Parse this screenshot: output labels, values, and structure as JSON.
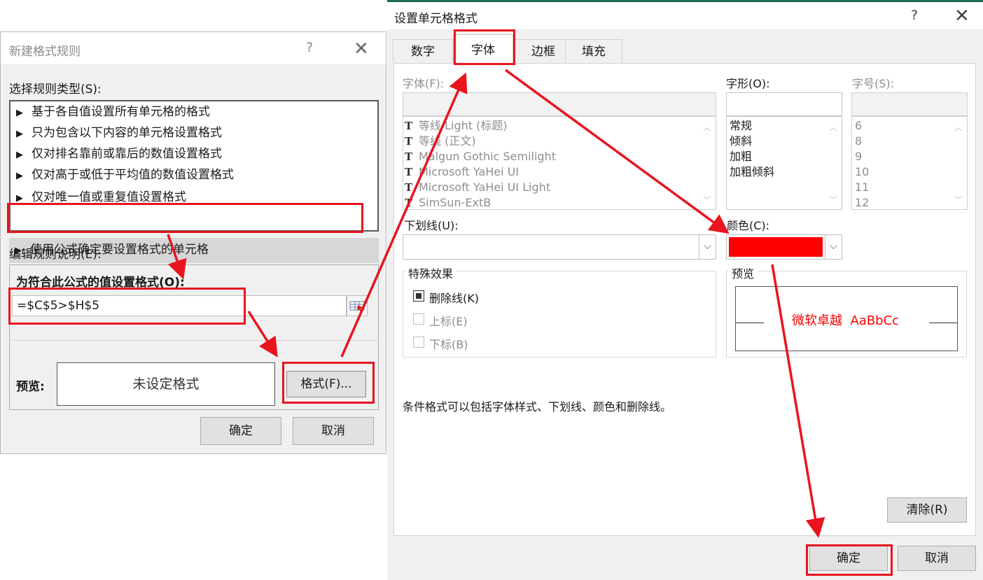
{
  "left_dialog": {
    "title": "新建格式规则",
    "help": "?",
    "close": "✕",
    "rule_type_label": "选择规则类型(S):",
    "rules": [
      "基于各自值设置所有单元格的格式",
      "只为包含以下内容的单元格设置格式",
      "仅对排名靠前或靠后的数值设置格式",
      "仅对高于或低于平均值的数值设置格式",
      "仅对唯一值或重复值设置格式",
      "使用公式确定要设置格式的单元格"
    ],
    "edit_desc_label": "编辑规则说明(E):",
    "formula_label": "为符合此公式的值设置格式(O):",
    "formula_value": "=$C$5>$H$5",
    "preview_label": "预览:",
    "preview_text": "未设定格式",
    "format_button": "格式(F)...",
    "ok_button": "确定",
    "cancel_button": "取消"
  },
  "right_dialog": {
    "title": "设置单元格格式",
    "help": "?",
    "close": "✕",
    "tabs": [
      "数字",
      "字体",
      "边框",
      "填充"
    ],
    "active_tab": "字体",
    "font_label": "字体(F):",
    "fonts": [
      "等线 Light (标题)",
      "等线 (正文)",
      "Malgun Gothic Semilight",
      "Microsoft YaHei UI",
      "Microsoft YaHei UI Light",
      "SimSun-ExtB"
    ],
    "style_label": "字形(O):",
    "styles": [
      "常规",
      "倾斜",
      "加粗",
      "加粗倾斜"
    ],
    "size_label": "字号(S):",
    "sizes": [
      "6",
      "8",
      "9",
      "10",
      "11",
      "12"
    ],
    "underline_label": "下划线(U):",
    "color_label": "颜色(C):",
    "color_value": "#ff0000",
    "effects_label": "特殊效果",
    "strikethrough": "删除线(K)",
    "superscript": "上标(E)",
    "subscript": "下标(B)",
    "preview_label": "预览",
    "preview_sample": "微软卓越  AaBbCc",
    "note": "条件格式可以包括字体样式、下划线、颜色和删除线。",
    "clear_button": "清除(R)",
    "ok_button": "确定",
    "cancel_button": "取消"
  },
  "annotation_color": "#e8141f"
}
